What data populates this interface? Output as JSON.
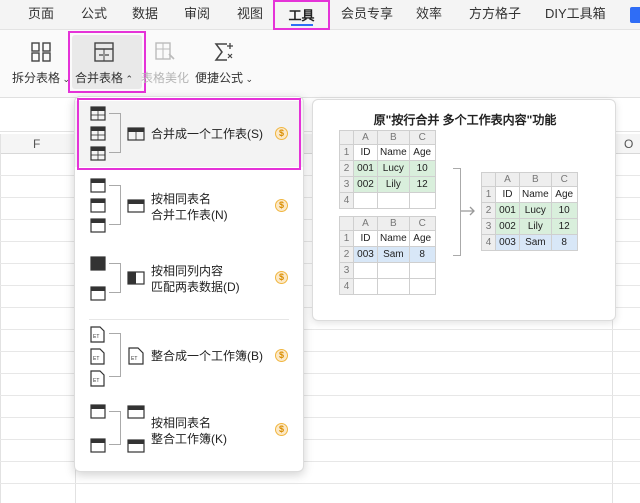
{
  "menubar": {
    "items": [
      "页面",
      "公式",
      "数据",
      "审阅",
      "视图",
      "工具",
      "会员专享",
      "效率",
      "方方格子",
      "DIY工具箱"
    ],
    "active": "工具"
  },
  "ribbon": {
    "split_sheet": "拆分表格",
    "merge_sheet": "合并表格",
    "beautify": "表格美化",
    "quick_formula": "便捷公式"
  },
  "sheet": {
    "col_f": "F",
    "col_o": "O"
  },
  "dropdown": {
    "items": [
      {
        "line1": "合并成一个工作表(S)",
        "line2": "",
        "badge": "$"
      },
      {
        "line1": "按相同表名",
        "line2": "合并工作表(N)",
        "badge": "$"
      },
      {
        "line1": "按相同列内容",
        "line2": "匹配两表数据(D)",
        "badge": "$"
      },
      {
        "line1": "整合成一个工作簿(B)",
        "line2": "",
        "badge": "$"
      },
      {
        "line1": "按相同表名",
        "line2": "整合工作簿(K)",
        "badge": "$"
      }
    ]
  },
  "preview": {
    "title": "原\"按行合并 多个工作表内容\"功能",
    "col_letters": [
      "A",
      "B",
      "C"
    ],
    "headers": [
      "ID",
      "Name",
      "Age"
    ],
    "table1": [
      [
        "001",
        "Lucy",
        "10"
      ],
      [
        "002",
        "Lily",
        "12"
      ]
    ],
    "table2": [
      [
        "003",
        "Sam",
        "8"
      ]
    ],
    "merged": [
      [
        "001",
        "Lucy",
        "10"
      ],
      [
        "002",
        "Lily",
        "12"
      ],
      [
        "003",
        "Sam",
        "8"
      ]
    ],
    "row_numbers": [
      "1",
      "2",
      "3",
      "4"
    ]
  },
  "colors": {
    "highlight": "#e533d8",
    "accent": "#2f6df6",
    "green_cell": "#d9efdc",
    "blue_cell": "#d8e7f7"
  }
}
